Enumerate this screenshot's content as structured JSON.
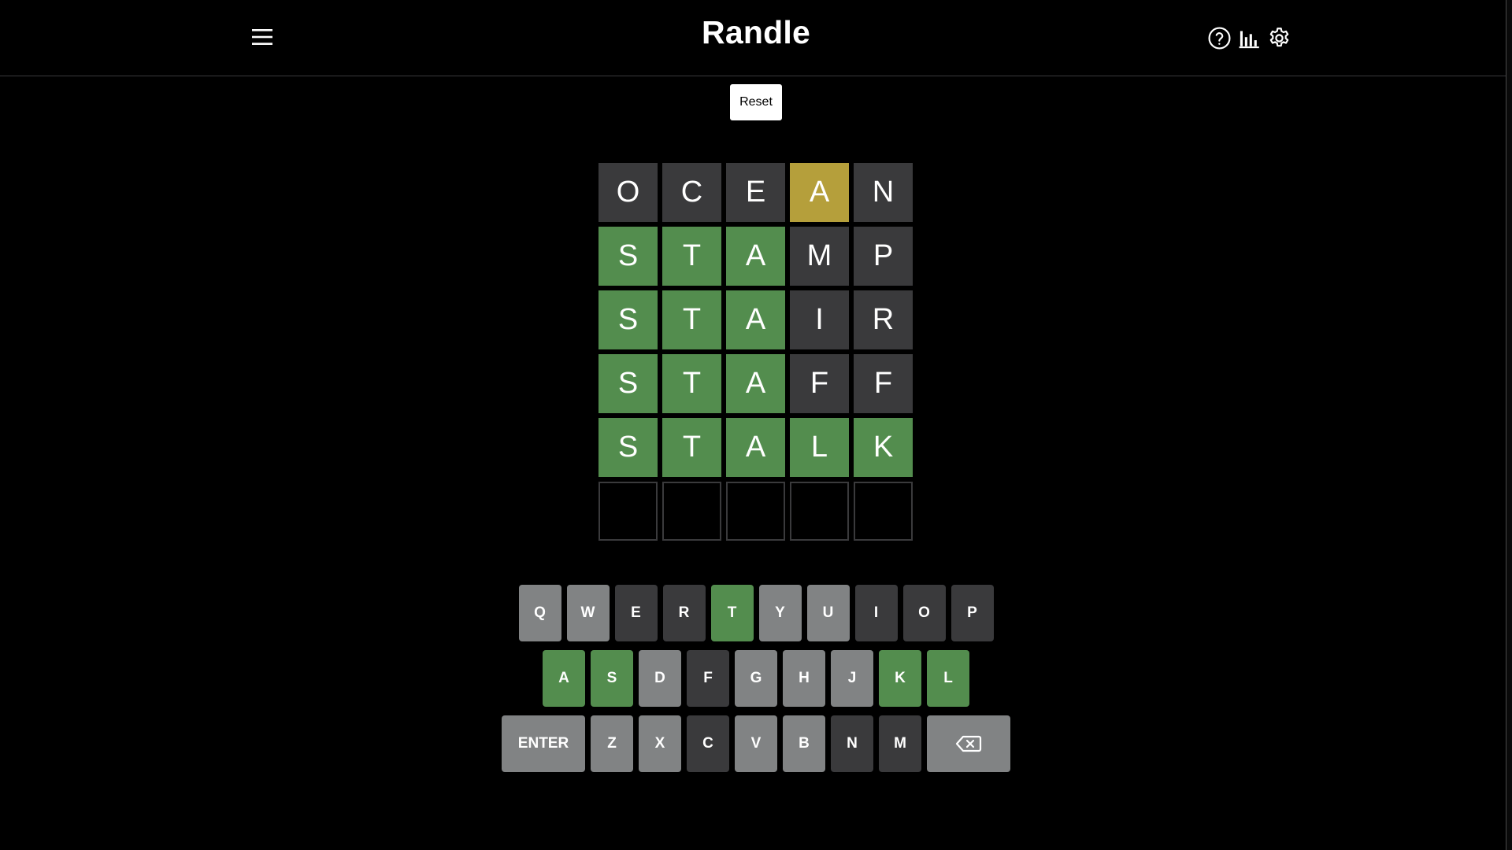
{
  "app": {
    "title": "Randle"
  },
  "toolbar": {
    "reset_label": "Reset"
  },
  "header_icons": [
    "help-icon",
    "stats-icon",
    "settings-icon"
  ],
  "colors": {
    "correct": "#538d4e",
    "present": "#b59f3b",
    "absent": "#3a3a3c",
    "unused": "#818384",
    "background": "#000000"
  },
  "board": {
    "rows": [
      [
        {
          "letter": "O",
          "state": "absent"
        },
        {
          "letter": "C",
          "state": "absent"
        },
        {
          "letter": "E",
          "state": "absent"
        },
        {
          "letter": "A",
          "state": "present"
        },
        {
          "letter": "N",
          "state": "absent"
        }
      ],
      [
        {
          "letter": "S",
          "state": "correct"
        },
        {
          "letter": "T",
          "state": "correct"
        },
        {
          "letter": "A",
          "state": "correct"
        },
        {
          "letter": "M",
          "state": "absent"
        },
        {
          "letter": "P",
          "state": "absent"
        }
      ],
      [
        {
          "letter": "S",
          "state": "correct"
        },
        {
          "letter": "T",
          "state": "correct"
        },
        {
          "letter": "A",
          "state": "correct"
        },
        {
          "letter": "I",
          "state": "absent"
        },
        {
          "letter": "R",
          "state": "absent"
        }
      ],
      [
        {
          "letter": "S",
          "state": "correct"
        },
        {
          "letter": "T",
          "state": "correct"
        },
        {
          "letter": "A",
          "state": "correct"
        },
        {
          "letter": "F",
          "state": "absent"
        },
        {
          "letter": "F",
          "state": "absent"
        }
      ],
      [
        {
          "letter": "S",
          "state": "correct"
        },
        {
          "letter": "T",
          "state": "correct"
        },
        {
          "letter": "A",
          "state": "correct"
        },
        {
          "letter": "L",
          "state": "correct"
        },
        {
          "letter": "K",
          "state": "correct"
        }
      ],
      [
        {
          "letter": "",
          "state": "empty"
        },
        {
          "letter": "",
          "state": "empty"
        },
        {
          "letter": "",
          "state": "empty"
        },
        {
          "letter": "",
          "state": "empty"
        },
        {
          "letter": "",
          "state": "empty"
        }
      ]
    ]
  },
  "keyboard": {
    "rows": [
      [
        {
          "label": "Q",
          "state": "unused"
        },
        {
          "label": "W",
          "state": "unused"
        },
        {
          "label": "E",
          "state": "absent"
        },
        {
          "label": "R",
          "state": "absent"
        },
        {
          "label": "T",
          "state": "correct"
        },
        {
          "label": "Y",
          "state": "unused"
        },
        {
          "label": "U",
          "state": "unused"
        },
        {
          "label": "I",
          "state": "absent"
        },
        {
          "label": "O",
          "state": "absent"
        },
        {
          "label": "P",
          "state": "absent"
        }
      ],
      [
        {
          "label": "A",
          "state": "correct"
        },
        {
          "label": "S",
          "state": "correct"
        },
        {
          "label": "D",
          "state": "unused"
        },
        {
          "label": "F",
          "state": "absent"
        },
        {
          "label": "G",
          "state": "unused"
        },
        {
          "label": "H",
          "state": "unused"
        },
        {
          "label": "J",
          "state": "unused"
        },
        {
          "label": "K",
          "state": "correct"
        },
        {
          "label": "L",
          "state": "correct"
        }
      ],
      [
        {
          "label": "ENTER",
          "state": "unused",
          "wide": true
        },
        {
          "label": "Z",
          "state": "unused"
        },
        {
          "label": "X",
          "state": "unused"
        },
        {
          "label": "C",
          "state": "absent"
        },
        {
          "label": "V",
          "state": "unused"
        },
        {
          "label": "B",
          "state": "unused"
        },
        {
          "label": "N",
          "state": "absent"
        },
        {
          "label": "M",
          "state": "absent"
        },
        {
          "label": "",
          "icon": "backspace-icon",
          "state": "unused",
          "wide": true
        }
      ]
    ]
  }
}
